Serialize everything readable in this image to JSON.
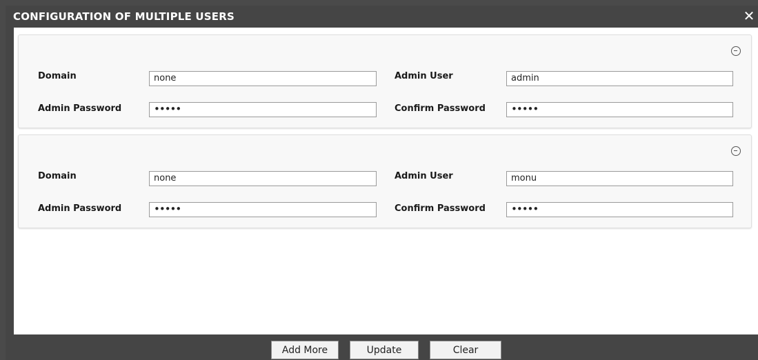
{
  "dialog": {
    "title": "CONFIGURATION OF MULTIPLE USERS",
    "close_glyph": "✕"
  },
  "entries": [
    {
      "domain_label": "Domain",
      "domain_value": "none",
      "admin_user_label": "Admin User",
      "admin_user_value": "admin",
      "admin_password_label": "Admin Password",
      "admin_password_value": "•••••",
      "confirm_password_label": "Confirm Password",
      "confirm_password_value": "•••••"
    },
    {
      "domain_label": "Domain",
      "domain_value": "none",
      "admin_user_label": "Admin User",
      "admin_user_value": "monu",
      "admin_password_label": "Admin Password",
      "admin_password_value": "•••••",
      "confirm_password_label": "Confirm Password",
      "confirm_password_value": "•••••"
    }
  ],
  "footer": {
    "add_more_label": "Add More",
    "update_label": "Update",
    "clear_label": "Clear"
  },
  "icons": {
    "close": "close-icon",
    "remove": "minus-circle-icon"
  },
  "colors": {
    "frame": "#454545",
    "content_bg": "#ffffff",
    "panel_bg": "#f8f8f8"
  }
}
